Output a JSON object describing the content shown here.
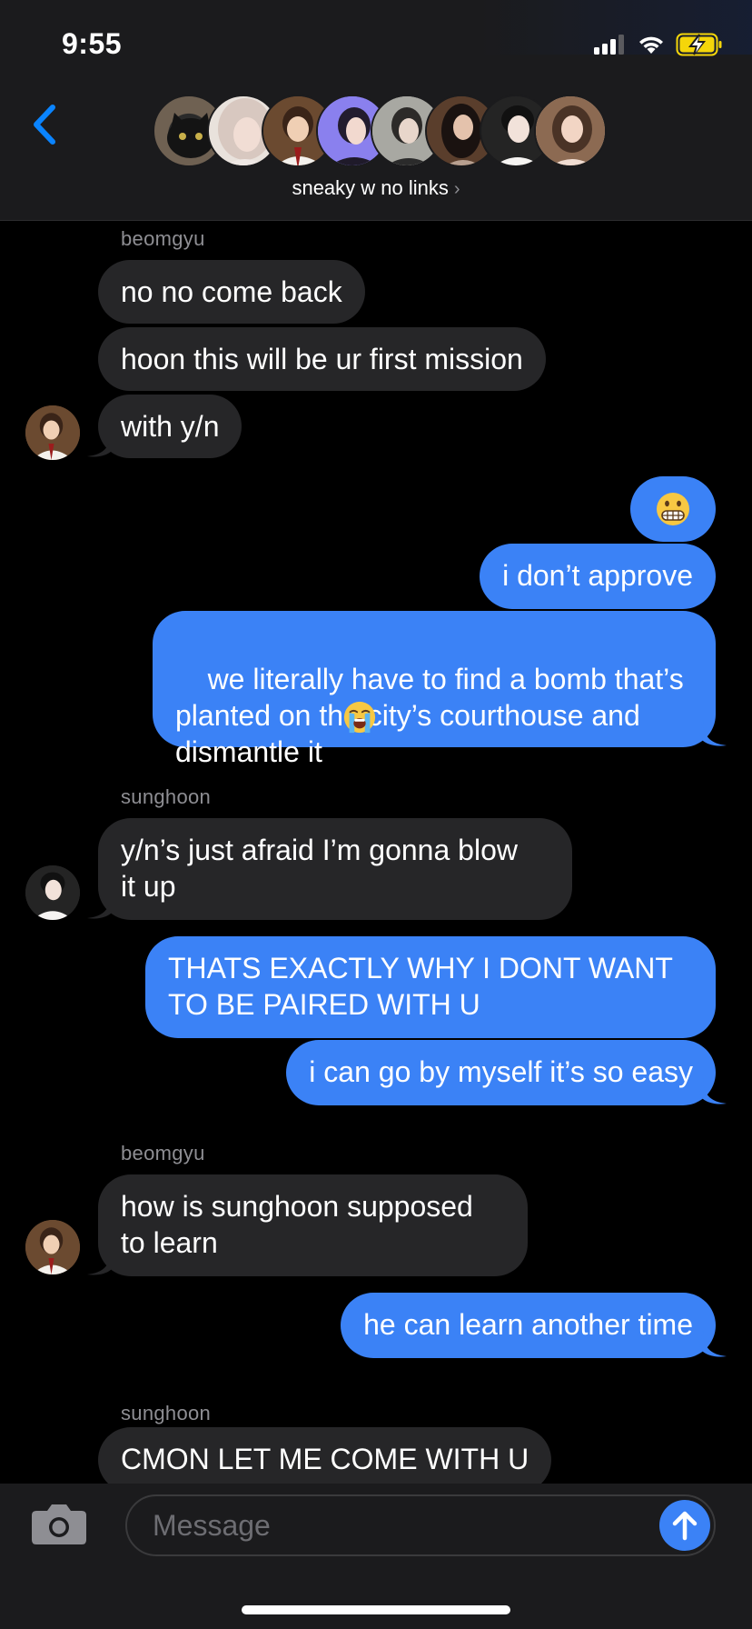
{
  "status_bar": {
    "time": "9:55"
  },
  "header": {
    "group_name": "sneaky w no links",
    "chevron": "›",
    "avatar_count": 8
  },
  "messages": [
    {
      "sender": "beomgyu"
    },
    {
      "text": "no no come back"
    },
    {
      "text": "hoon this will be ur first mission"
    },
    {
      "text": "with y/n"
    },
    {
      "emoji": "grimacing-face"
    },
    {
      "text": "i don’t approve"
    },
    {
      "text": "we literally have to find a bomb that’s\nplanted on the city’s courthouse and\ndismantle it",
      "emoji": "loudly-crying-face"
    },
    {
      "sender": "sunghoon"
    },
    {
      "text": "y/n’s just afraid I’m gonna blow\nit up"
    },
    {
      "text": "THATS EXACTLY WHY I DONT WANT\nTO BE PAIRED WITH U"
    },
    {
      "text": "i can go by myself it’s so easy"
    },
    {
      "sender": "beomgyu"
    },
    {
      "text": "how is sunghoon supposed\nto learn"
    },
    {
      "text": "he can learn another time"
    },
    {
      "sender": "sunghoon"
    },
    {
      "text": "CMON LET ME COME WITH U"
    }
  ],
  "composer": {
    "placeholder": "Message"
  },
  "colors": {
    "outgoing": "#3b82f6",
    "incoming": "#262628",
    "accent": "#0a84ff"
  }
}
